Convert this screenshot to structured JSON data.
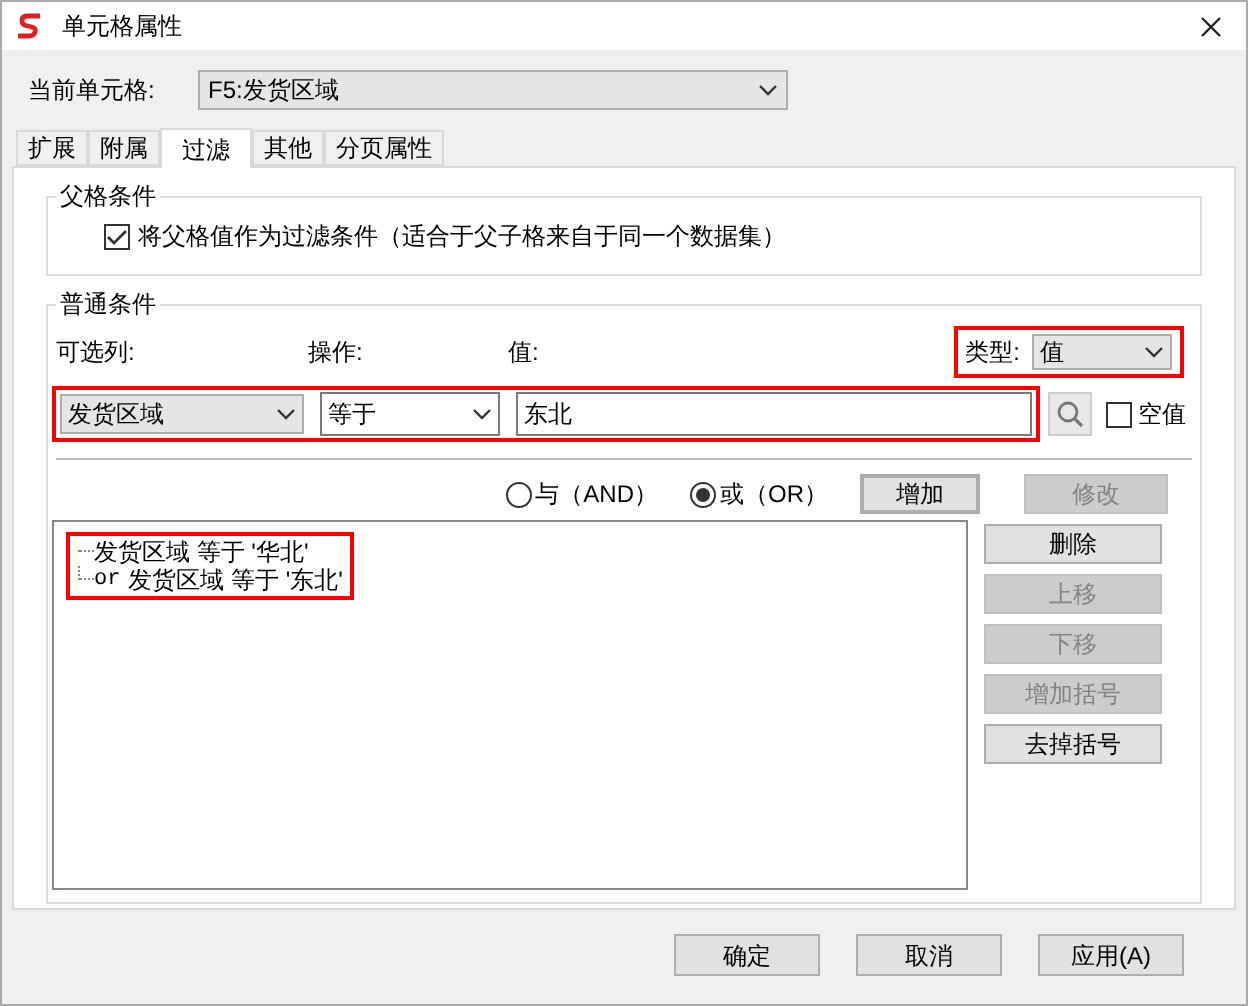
{
  "window": {
    "title": "单元格属性"
  },
  "current_cell": {
    "label": "当前单元格:",
    "value": "F5:发货区域"
  },
  "tabs": [
    {
      "label": "扩展",
      "selected": false
    },
    {
      "label": "附属",
      "selected": false
    },
    {
      "label": "过滤",
      "selected": true
    },
    {
      "label": "其他",
      "selected": false
    },
    {
      "label": "分页属性",
      "selected": false
    }
  ],
  "parent_condition": {
    "title": "父格条件",
    "checkbox": {
      "label": "将父格值作为过滤条件（适合于父子格来自于同一个数据集）",
      "checked": true
    }
  },
  "normal_condition": {
    "title": "普通条件",
    "column_label": "可选列:",
    "operation_label": "操作:",
    "value_label": "值:",
    "type_label": "类型:",
    "type_value": "值",
    "column_value": "发货区域",
    "operation_value": "等于",
    "value": "东北",
    "null_checkbox": {
      "label": "空值",
      "checked": false
    },
    "logic_options": [
      {
        "label": "与（AND）",
        "selected": false
      },
      {
        "label": "或（OR）",
        "selected": true
      }
    ],
    "add_button": {
      "label": "增加",
      "disabled": false
    },
    "modify_button": {
      "label": "修改",
      "disabled": true
    },
    "conditions": [
      {
        "text": "发货区域 等于 '华北'"
      },
      {
        "prefix": "or",
        "text": "发货区域 等于 '东北'"
      }
    ],
    "side_buttons": [
      {
        "label": "删除",
        "disabled": false
      },
      {
        "label": "上移",
        "disabled": true
      },
      {
        "label": "下移",
        "disabled": true
      },
      {
        "label": "增加括号",
        "disabled": true
      },
      {
        "label": "去掉括号",
        "disabled": false
      }
    ]
  },
  "footer_buttons": [
    {
      "label": "确定"
    },
    {
      "label": "取消"
    },
    {
      "label": "应用(A)"
    }
  ]
}
